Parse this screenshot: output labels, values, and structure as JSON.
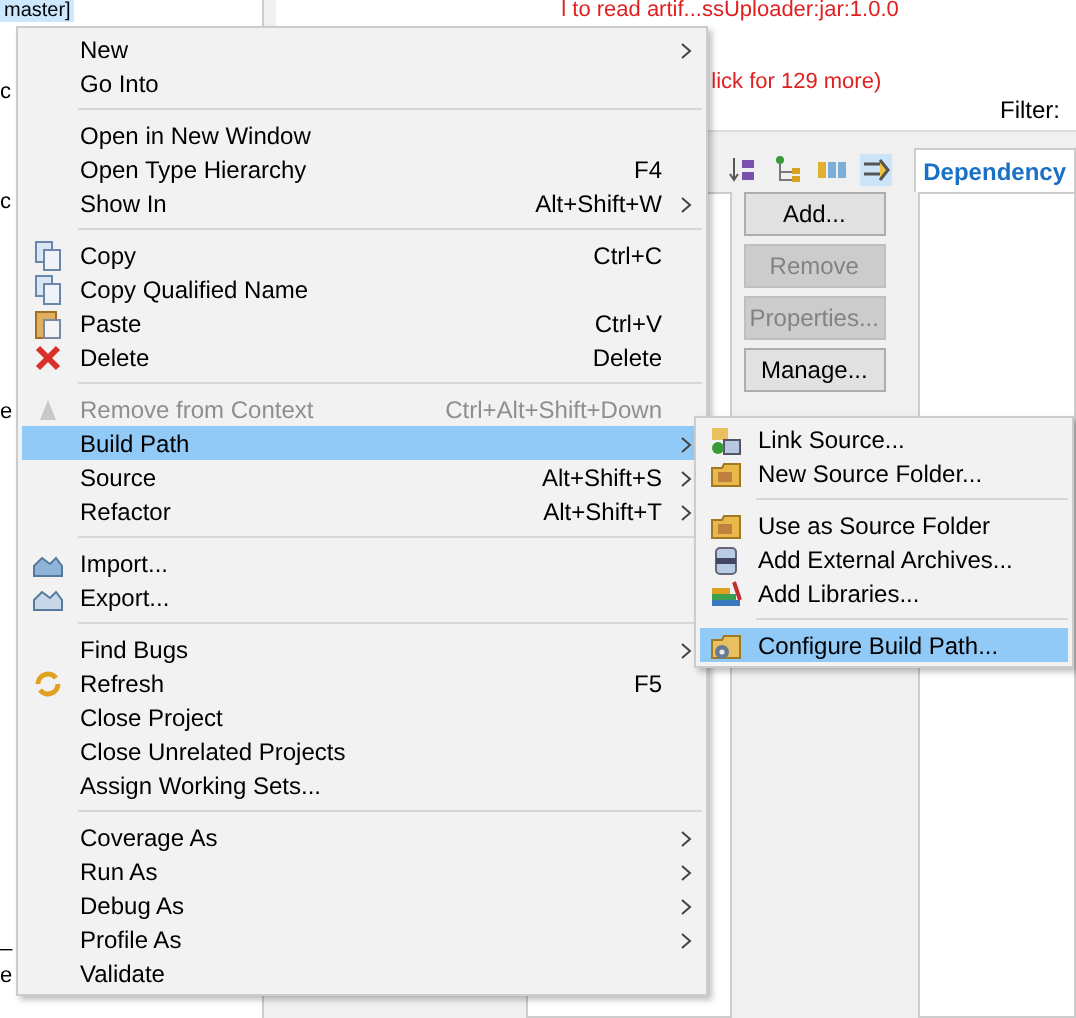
{
  "background": {
    "tree_label": "master]",
    "left_fragments": [
      "c",
      "c",
      "e",
      "_",
      "e"
    ],
    "error_line": "l to read artif...ssUploader:jar:1.0.0",
    "more_link": "lick for 129 more)",
    "filter_label": "Filter:",
    "tab": "Dependency",
    "buttons": [
      {
        "label": "Add...",
        "disabled": false
      },
      {
        "label": "Remove",
        "disabled": true
      },
      {
        "label": "Properties...",
        "disabled": true
      },
      {
        "label": "Manage...",
        "disabled": false
      }
    ]
  },
  "context_menu": [
    {
      "kind": "item",
      "label": "New",
      "submenu": true,
      "selected": false,
      "disabled": false
    },
    {
      "kind": "item",
      "label": "Go Into",
      "submenu": false,
      "selected": false,
      "disabled": false
    },
    {
      "kind": "separator"
    },
    {
      "kind": "item",
      "label": "Open in New Window",
      "submenu": false,
      "selected": false,
      "disabled": false
    },
    {
      "kind": "item",
      "label": "Open Type Hierarchy",
      "shortcut": "F4",
      "submenu": false,
      "selected": false,
      "disabled": false
    },
    {
      "kind": "item",
      "label": "Show In",
      "shortcut": "Alt+Shift+W",
      "submenu": true,
      "selected": false,
      "disabled": false
    },
    {
      "kind": "separator"
    },
    {
      "kind": "item",
      "label": "Copy",
      "shortcut": "Ctrl+C",
      "submenu": false,
      "selected": false,
      "disabled": false
    },
    {
      "kind": "item",
      "label": "Copy Qualified Name",
      "submenu": false,
      "selected": false,
      "disabled": false
    },
    {
      "kind": "item",
      "label": "Paste",
      "shortcut": "Ctrl+V",
      "submenu": false,
      "selected": false,
      "disabled": false
    },
    {
      "kind": "item",
      "label": "Delete",
      "shortcut": "Delete",
      "submenu": false,
      "selected": false,
      "disabled": false
    },
    {
      "kind": "separator"
    },
    {
      "kind": "item",
      "label": "Remove from Context",
      "shortcut": "Ctrl+Alt+Shift+Down",
      "submenu": false,
      "selected": false,
      "disabled": true
    },
    {
      "kind": "item",
      "label": "Build Path",
      "submenu": true,
      "selected": true,
      "disabled": false
    },
    {
      "kind": "item",
      "label": "Source",
      "shortcut": "Alt+Shift+S",
      "submenu": true,
      "selected": false,
      "disabled": false
    },
    {
      "kind": "item",
      "label": "Refactor",
      "shortcut": "Alt+Shift+T",
      "submenu": true,
      "selected": false,
      "disabled": false
    },
    {
      "kind": "separator"
    },
    {
      "kind": "item",
      "label": "Import...",
      "submenu": false,
      "selected": false,
      "disabled": false
    },
    {
      "kind": "item",
      "label": "Export...",
      "submenu": false,
      "selected": false,
      "disabled": false
    },
    {
      "kind": "separator"
    },
    {
      "kind": "item",
      "label": "Find Bugs",
      "submenu": true,
      "selected": false,
      "disabled": false
    },
    {
      "kind": "item",
      "label": "Refresh",
      "shortcut": "F5",
      "submenu": false,
      "selected": false,
      "disabled": false
    },
    {
      "kind": "item",
      "label": "Close Project",
      "submenu": false,
      "selected": false,
      "disabled": false
    },
    {
      "kind": "item",
      "label": "Close Unrelated Projects",
      "submenu": false,
      "selected": false,
      "disabled": false
    },
    {
      "kind": "item",
      "label": "Assign Working Sets...",
      "submenu": false,
      "selected": false,
      "disabled": false
    },
    {
      "kind": "separator"
    },
    {
      "kind": "item",
      "label": "Coverage As",
      "submenu": true,
      "selected": false,
      "disabled": false
    },
    {
      "kind": "item",
      "label": "Run As",
      "submenu": true,
      "selected": false,
      "disabled": false
    },
    {
      "kind": "item",
      "label": "Debug As",
      "submenu": true,
      "selected": false,
      "disabled": false
    },
    {
      "kind": "item",
      "label": "Profile As",
      "submenu": true,
      "selected": false,
      "disabled": false
    },
    {
      "kind": "item",
      "label": "Validate",
      "submenu": false,
      "selected": false,
      "disabled": false
    }
  ],
  "build_path_submenu": [
    {
      "kind": "item",
      "label": "Link Source...",
      "selected": false
    },
    {
      "kind": "item",
      "label": "New Source Folder...",
      "selected": false
    },
    {
      "kind": "separator"
    },
    {
      "kind": "item",
      "label": "Use as Source Folder",
      "selected": false
    },
    {
      "kind": "item",
      "label": "Add External Archives...",
      "selected": false
    },
    {
      "kind": "item",
      "label": "Add Libraries...",
      "selected": false
    },
    {
      "kind": "separator"
    },
    {
      "kind": "item",
      "label": "Configure Build Path...",
      "selected": true
    }
  ]
}
